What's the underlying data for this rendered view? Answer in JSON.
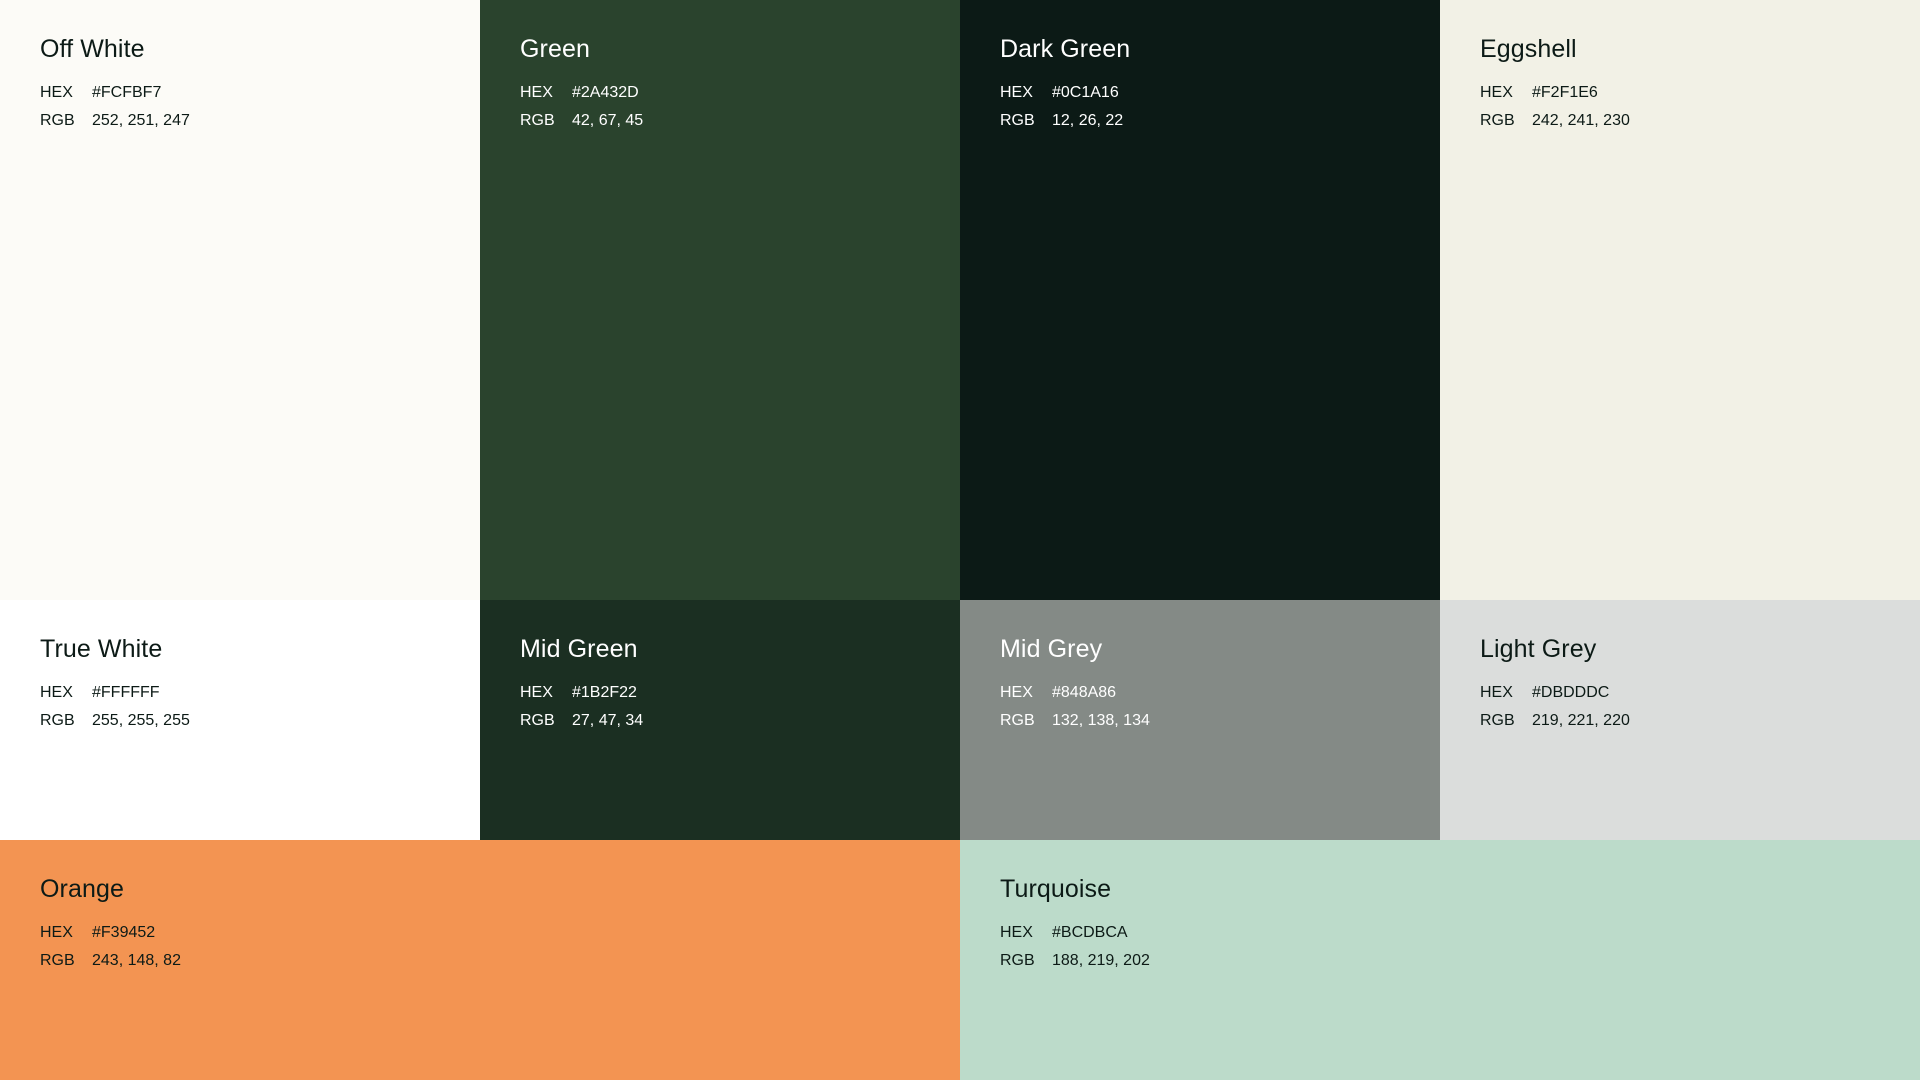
{
  "labels": {
    "hex": "HEX",
    "rgb": "RGB"
  },
  "swatches": [
    {
      "name": "Off White",
      "hex": "#FCFBF7",
      "rgb": "252, 251, 247",
      "text_color": "#0C1A16"
    },
    {
      "name": "Green",
      "hex": "#2A432D",
      "rgb": "42, 67, 45",
      "text_color": "#FFFFFF"
    },
    {
      "name": "Dark Green",
      "hex": "#0C1A16",
      "rgb": "12, 26, 22",
      "text_color": "#FFFFFF"
    },
    {
      "name": "Eggshell",
      "hex": "#F2F1E6",
      "rgb": "242, 241, 230",
      "text_color": "#0C1A16"
    },
    {
      "name": "True White",
      "hex": "#FFFFFF",
      "rgb": "255, 255, 255",
      "text_color": "#0C1A16"
    },
    {
      "name": "Mid Green",
      "hex": "#1B2F22",
      "rgb": "27, 47, 34",
      "text_color": "#FFFFFF"
    },
    {
      "name": "Mid Grey",
      "hex": "#848A86",
      "rgb": "132, 138, 134",
      "text_color": "#FFFFFF"
    },
    {
      "name": "Light Grey",
      "hex": "#DBDDDC",
      "rgb": "219, 221, 220",
      "text_color": "#0C1A16"
    },
    {
      "name": "Orange",
      "hex": "#F39452",
      "rgb": "243, 148, 82",
      "text_color": "#0C1A16"
    },
    {
      "name": "Turquoise",
      "hex": "#BCDBCA",
      "rgb": "188, 219, 202",
      "text_color": "#0C1A16"
    }
  ]
}
